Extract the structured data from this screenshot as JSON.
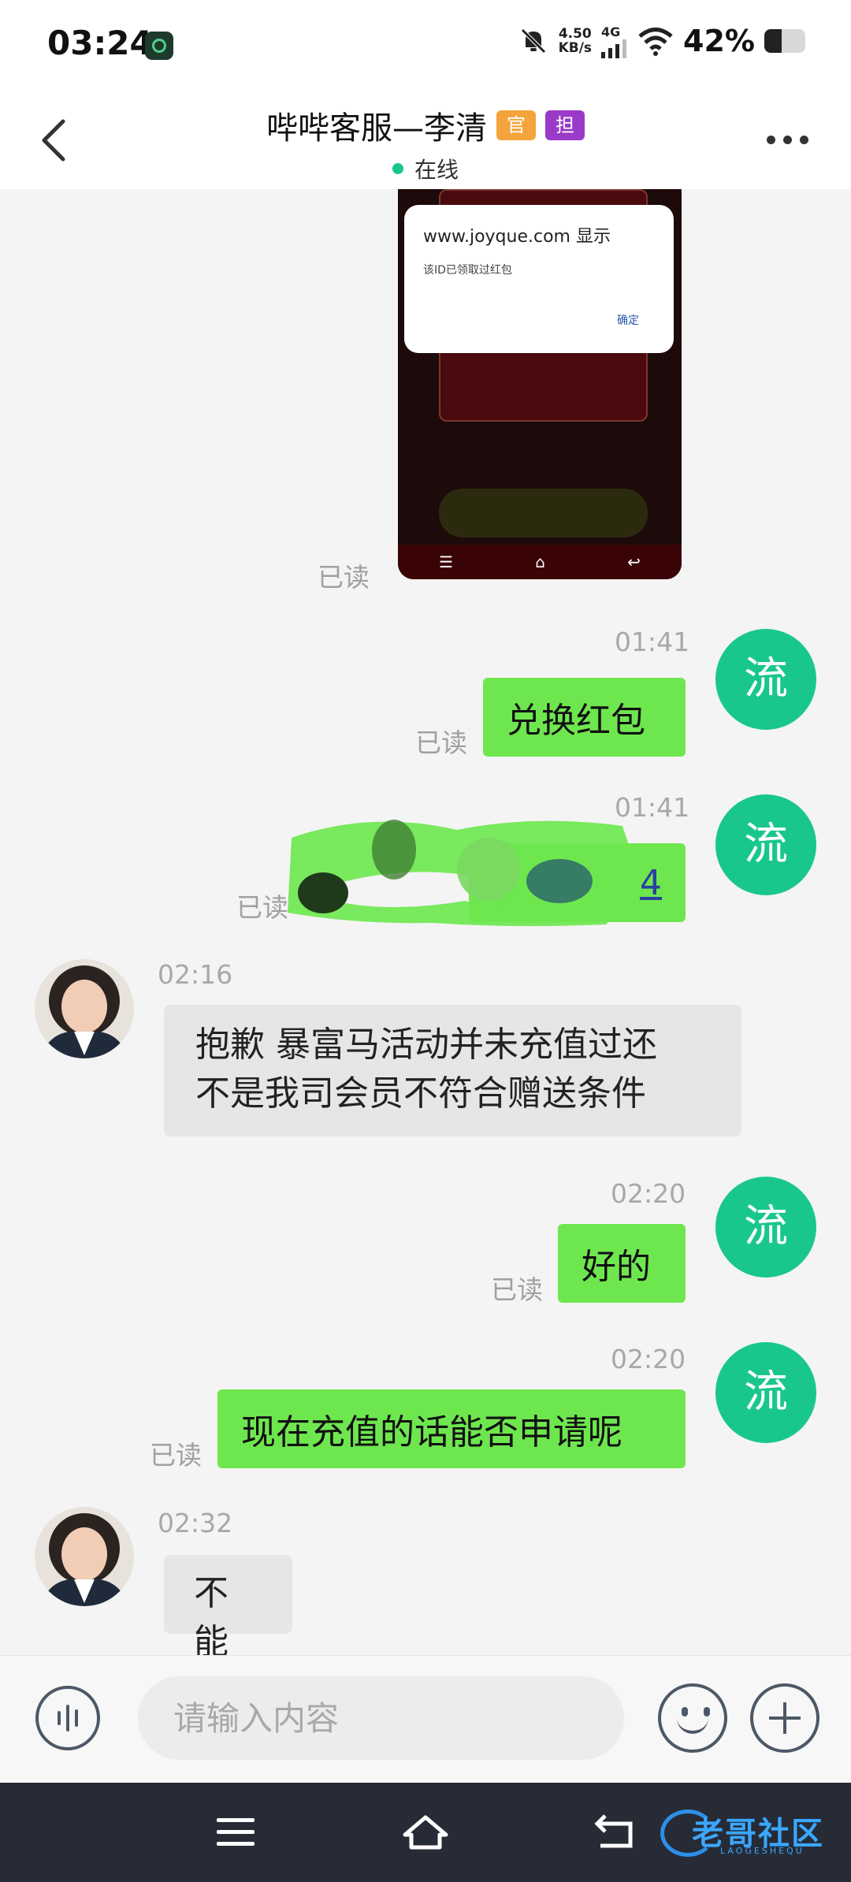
{
  "status_bar": {
    "time": "03:24",
    "net_speed_value": "4.50",
    "net_speed_unit": "KB/s",
    "network_type": "4G",
    "battery_percent_text": "42%",
    "battery_level": 0.42
  },
  "header": {
    "title": "哔哔客服—李清",
    "badge_official": "官",
    "badge_guarantee": "担",
    "status_text": "在线"
  },
  "screenshot_message": {
    "dialog_title": "www.joyque.com 显示",
    "dialog_message": "该ID已领取过红包",
    "dialog_button": "确定",
    "read_label": "已读"
  },
  "messages": [
    {
      "sender": "me",
      "time": "01:41",
      "text": "兑换红包",
      "read": "已读",
      "avatar_text": "流"
    },
    {
      "sender": "me",
      "time": "01:41",
      "text": "4",
      "read": "已读",
      "avatar_text": "流",
      "redacted": true
    },
    {
      "sender": "agent",
      "time": "02:16",
      "text_line1": "抱歉 暴富马活动并未充值过还",
      "text_line2": "不是我司会员不符合赠送条件"
    },
    {
      "sender": "me",
      "time": "02:20",
      "text": "好的",
      "read": "已读",
      "avatar_text": "流"
    },
    {
      "sender": "me",
      "time": "02:20",
      "text": "现在充值的话能否申请呢",
      "read": "已读",
      "avatar_text": "流"
    },
    {
      "sender": "agent",
      "time": "02:32",
      "text": "不能"
    }
  ],
  "input_bar": {
    "placeholder": "请输入内容"
  },
  "watermark": {
    "text": "老哥社区",
    "subtext": "LAOGESHEQU"
  },
  "colors": {
    "my_bubble": "#6ee74f",
    "agent_bubble": "#e6e6e6",
    "my_avatar": "#19c78e",
    "online_dot": "#19c78e",
    "badge_official": "#f3a43b",
    "badge_guarantee": "#9a3ac7"
  }
}
